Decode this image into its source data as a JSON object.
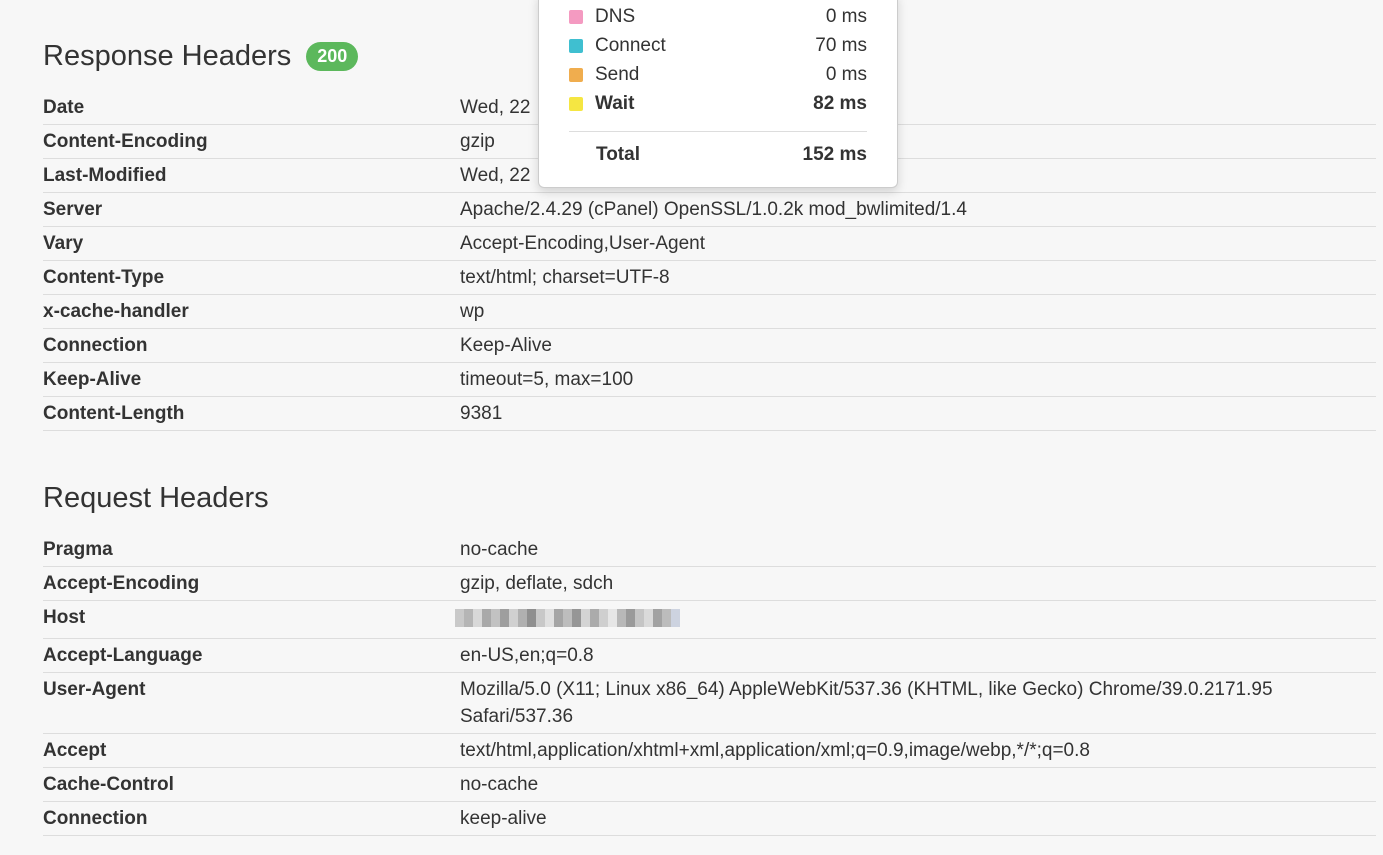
{
  "response": {
    "title": "Response Headers",
    "status": "200",
    "headers": [
      {
        "key": "Date",
        "value": "Wed, 22"
      },
      {
        "key": "Content-Encoding",
        "value": "gzip"
      },
      {
        "key": "Last-Modified",
        "value": "Wed, 22"
      },
      {
        "key": "Server",
        "value": "Apache/2.4.29 (cPanel) OpenSSL/1.0.2k mod_bwlimited/1.4"
      },
      {
        "key": "Vary",
        "value": "Accept-Encoding,User-Agent"
      },
      {
        "key": "Content-Type",
        "value": "text/html; charset=UTF-8"
      },
      {
        "key": "x-cache-handler",
        "value": "wp"
      },
      {
        "key": "Connection",
        "value": "Keep-Alive"
      },
      {
        "key": "Keep-Alive",
        "value": "timeout=5, max=100"
      },
      {
        "key": "Content-Length",
        "value": "9381"
      }
    ]
  },
  "request": {
    "title": "Request Headers",
    "headers": [
      {
        "key": "Pragma",
        "value": "no-cache"
      },
      {
        "key": "Accept-Encoding",
        "value": "gzip, deflate, sdch"
      },
      {
        "key": "Host",
        "value": ""
      },
      {
        "key": "Accept-Language",
        "value": "en-US,en;q=0.8"
      },
      {
        "key": "User-Agent",
        "value": "Mozilla/5.0 (X11; Linux x86_64) AppleWebKit/537.36 (KHTML, like Gecko) Chrome/39.0.2171.95 Safari/537.36"
      },
      {
        "key": "Accept",
        "value": "text/html,application/xhtml+xml,application/xml;q=0.9,image/webp,*/*;q=0.8"
      },
      {
        "key": "Cache-Control",
        "value": "no-cache"
      },
      {
        "key": "Connection",
        "value": "keep-alive"
      }
    ]
  },
  "timing": {
    "rows": [
      {
        "name": "DNS",
        "value": "0 ms",
        "color": "#f49ac1"
      },
      {
        "name": "Connect",
        "value": "70 ms",
        "color": "#3fbfd0"
      },
      {
        "name": "Send",
        "value": "0 ms",
        "color": "#f0ad4e"
      },
      {
        "name": "Wait",
        "value": "82 ms",
        "color": "#f5e642"
      }
    ],
    "total_label": "Total",
    "total_value": "152 ms"
  },
  "colors": {
    "status_badge": "#5cb85c"
  }
}
